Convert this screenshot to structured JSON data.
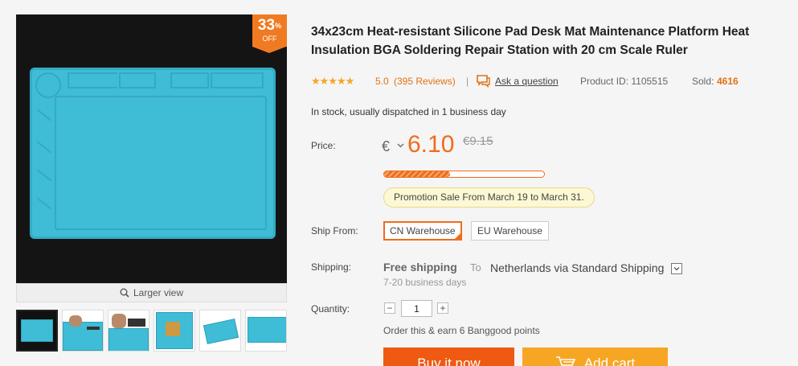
{
  "gallery": {
    "discount_value": "33",
    "discount_sign": "%",
    "discount_off": "OFF",
    "larger_view": "Larger view",
    "thumbnails": [
      "thumb-1",
      "thumb-2",
      "thumb-3",
      "thumb-4",
      "thumb-5",
      "thumb-6"
    ],
    "mat_color": "#3fbcd6"
  },
  "product": {
    "title": "34x23cm Heat-resistant Silicone Pad Desk Mat Maintenance Platform Heat Insulation BGA Soldering Repair Station with 20 cm Scale Ruler",
    "stars": "★★★★★",
    "rating": "5.0",
    "reviews": "(395 Reviews)",
    "separator": "|",
    "ask_question": "Ask a question",
    "product_id": "Product ID: 1105515",
    "sold_label": "Sold:",
    "sold_value": "4616",
    "stock": "In stock, usually dispatched in 1 business day"
  },
  "price": {
    "label": "Price:",
    "currency": "€",
    "current": "6.10",
    "original": "€9.15",
    "sale_progress": 0.41,
    "promotion": "Promotion Sale From March 19 to March 31."
  },
  "ship_from": {
    "label": "Ship From:",
    "options": [
      "CN Warehouse",
      "EU Warehouse"
    ],
    "selected": "CN Warehouse"
  },
  "shipping": {
    "label": "Shipping:",
    "free": "Free shipping",
    "to": "To",
    "destination": "Netherlands via Standard Shipping",
    "days": "7-20 business days"
  },
  "quantity": {
    "label": "Quantity:",
    "minus": "−",
    "plus": "+",
    "value": "1",
    "points": "Order this & earn 6 Banggood points"
  },
  "actions": {
    "buy_now": "Buy it now",
    "add_cart": "Add cart"
  },
  "colors": {
    "accent": "#ef6c1c",
    "buy": "#ef5a13",
    "cart": "#f7a624",
    "star": "#f5a623"
  }
}
